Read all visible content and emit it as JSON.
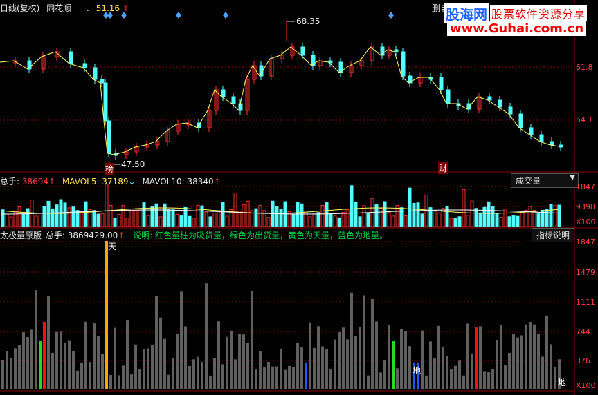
{
  "header": {
    "period_label": "日线(复权)",
    "stock_name": "同花顺",
    "price_prefix": ".",
    "price": "51.16",
    "price_arrow": "↑",
    "right_label": "删自"
  },
  "watermark": {
    "brand_cn": "股海网",
    "tagline": "股票软件资源分享",
    "url": "www.Guhai.com.cn"
  },
  "price_panel": {
    "y_labels": [
      "61.8",
      "54.1"
    ],
    "high_label": "68.35",
    "low_label": "47.50",
    "marker_left": "榜",
    "marker_right": "财"
  },
  "volume_panel": {
    "total_label": "总手: ",
    "total_value": "38694",
    "total_arrow": "↑",
    "mavol5_label": "MAVOL5: ",
    "mavol5_value": "37189",
    "mavol5_arrow": "↓",
    "mavol10_label": "MAVOL10: ",
    "mavol10_value": "38340",
    "mavol10_arrow": "↑",
    "dropdown_label": "成交量",
    "y_labels": [
      "1847",
      "9398",
      "X100"
    ]
  },
  "indicator_panel": {
    "name": "太极量原版",
    "total_label": "总手: ",
    "total_value": "3869429.00",
    "total_arrow": "↑",
    "description": "说明: 红色量柱为吸货量，绿色为出货量，黄色为天量，蓝色为地量。",
    "button_label": "指标说明",
    "y_labels": [
      "1847",
      "1479",
      "1111",
      "744.",
      "376.",
      "X100"
    ],
    "tian_label": "天",
    "di_label": "地"
  },
  "colors": {
    "up": "#ff3030",
    "down": "#54ffff",
    "ma": "#ffff66",
    "grid": "#8b0000",
    "absorb": "#ff1010",
    "distribute": "#22dd22",
    "sky": "#ffa500",
    "ground": "#1e5bff",
    "normal": "#606060"
  },
  "icons": [
    "diamond-icon",
    "arrow-up-icon",
    "arrow-down-icon",
    "dropdown-triangle-icon"
  ]
}
